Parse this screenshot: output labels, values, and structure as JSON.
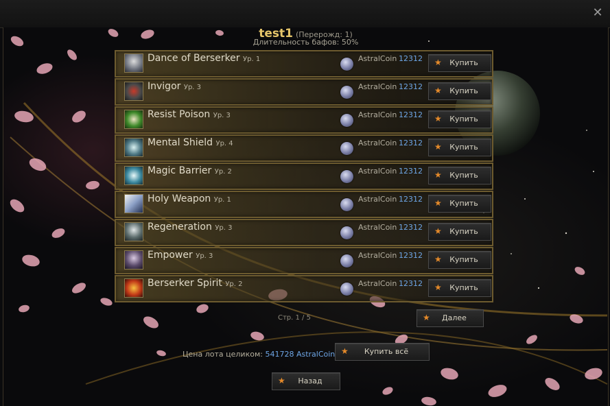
{
  "header": {
    "player_name": "test1",
    "rebirth_text": "(Перерожд: 1)",
    "buff_duration": "Длительность бафов: 50%"
  },
  "buffs": [
    {
      "name": "Dance of Berserker",
      "level": "Ур. 1",
      "currency": "AstralCoin",
      "price": "12312",
      "buy_label": "Купить",
      "icon": "dance-of-berserker-icon"
    },
    {
      "name": "Invigor",
      "level": "Ур. 3",
      "currency": "AstralCoin",
      "price": "12312",
      "buy_label": "Купить",
      "icon": "invigor-icon"
    },
    {
      "name": "Resist Poison",
      "level": "Ур. 3",
      "currency": "AstralCoin",
      "price": "12312",
      "buy_label": "Купить",
      "icon": "resist-poison-icon"
    },
    {
      "name": "Mental Shield",
      "level": "Ур. 4",
      "currency": "AstralCoin",
      "price": "12312",
      "buy_label": "Купить",
      "icon": "mental-shield-icon"
    },
    {
      "name": "Magic Barrier",
      "level": "Ур. 2",
      "currency": "AstralCoin",
      "price": "12312",
      "buy_label": "Купить",
      "icon": "magic-barrier-icon"
    },
    {
      "name": "Holy Weapon",
      "level": "Ур. 1",
      "currency": "AstralCoin",
      "price": "12312",
      "buy_label": "Купить",
      "icon": "holy-weapon-icon"
    },
    {
      "name": "Regeneration",
      "level": "Ур. 3",
      "currency": "AstralCoin",
      "price": "12312",
      "buy_label": "Купить",
      "icon": "regeneration-icon"
    },
    {
      "name": "Empower",
      "level": "Ур. 3",
      "currency": "AstralCoin",
      "price": "12312",
      "buy_label": "Купить",
      "icon": "empower-icon"
    },
    {
      "name": "Berserker Spirit",
      "level": "Ур. 2",
      "currency": "AstralCoin",
      "price": "12312",
      "buy_label": "Купить",
      "icon": "berserker-spirit-icon"
    }
  ],
  "pagination": {
    "page_text": "Стр. 1 / 5",
    "next_label": "Далее"
  },
  "lot": {
    "label": "Цена лота целиком:",
    "value": "541728 AstralCoin",
    "buy_all_label": "Купить всё"
  },
  "back_label": "Назад",
  "window": {
    "close_icon": "close-icon"
  },
  "colors": {
    "accent_gold": "#e5c56a",
    "price_blue": "#6ea6e6",
    "star_orange": "#e58a2a",
    "row_border": "#6d5b2f"
  }
}
